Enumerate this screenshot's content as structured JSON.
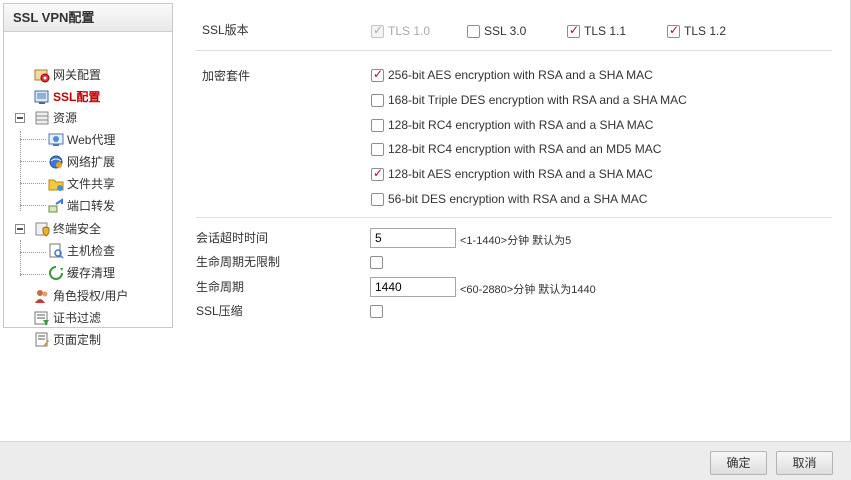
{
  "sidebar": {
    "title": "SSL VPN配置",
    "items": [
      {
        "label": "网关配置",
        "icon": "gateway-config-icon"
      },
      {
        "label": "SSL配置",
        "icon": "ssl-config-icon",
        "active": true
      },
      {
        "label": "资源",
        "icon": "resource-icon"
      },
      {
        "label": "Web代理",
        "icon": "web-proxy-icon"
      },
      {
        "label": "网络扩展",
        "icon": "network-extension-icon"
      },
      {
        "label": "文件共享",
        "icon": "file-share-icon"
      },
      {
        "label": "端口转发",
        "icon": "port-forward-icon"
      },
      {
        "label": "终端安全",
        "icon": "endpoint-security-icon"
      },
      {
        "label": "主机检查",
        "icon": "host-check-icon"
      },
      {
        "label": "缓存清理",
        "icon": "cache-clean-icon"
      },
      {
        "label": "角色授权/用户",
        "icon": "role-user-icon"
      },
      {
        "label": "证书过滤",
        "icon": "cert-filter-icon"
      },
      {
        "label": "页面定制",
        "icon": "page-custom-icon"
      }
    ]
  },
  "ssl_version": {
    "label": "SSL版本",
    "options": [
      {
        "label": "TLS 1.0",
        "checked": true,
        "disabled": true
      },
      {
        "label": "SSL 3.0",
        "checked": false,
        "disabled": false
      },
      {
        "label": "TLS 1.1",
        "checked": true,
        "disabled": false
      },
      {
        "label": "TLS 1.2",
        "checked": true,
        "disabled": false
      }
    ]
  },
  "cipher_suite": {
    "label": "加密套件",
    "options": [
      {
        "label": "256-bit AES encryption with RSA and a SHA MAC",
        "checked": true
      },
      {
        "label": "168-bit Triple DES encryption with RSA and a SHA MAC",
        "checked": false
      },
      {
        "label": "128-bit RC4 encryption with RSA and a SHA MAC",
        "checked": false
      },
      {
        "label": "128-bit RC4 encryption with RSA and an MD5 MAC",
        "checked": false
      },
      {
        "label": "128-bit AES encryption with RSA and a SHA MAC",
        "checked": true
      },
      {
        "label": "56-bit DES encryption with RSA and a SHA MAC",
        "checked": false
      }
    ]
  },
  "session_timeout": {
    "label": "会话超时时间",
    "value": "5",
    "hint": "<1-1440>分钟 默认为5"
  },
  "lifetime_unlimited": {
    "label": "生命周期无限制",
    "checked": false
  },
  "lifetime": {
    "label": "生命周期",
    "value": "1440",
    "hint": "<60-2880>分钟 默认为1440"
  },
  "ssl_compress": {
    "label": "SSL压缩",
    "checked": false
  },
  "footer": {
    "ok_label": "确定",
    "cancel_label": "取消"
  },
  "colors": {
    "accent": "#c00000",
    "check": "#b3002d"
  }
}
